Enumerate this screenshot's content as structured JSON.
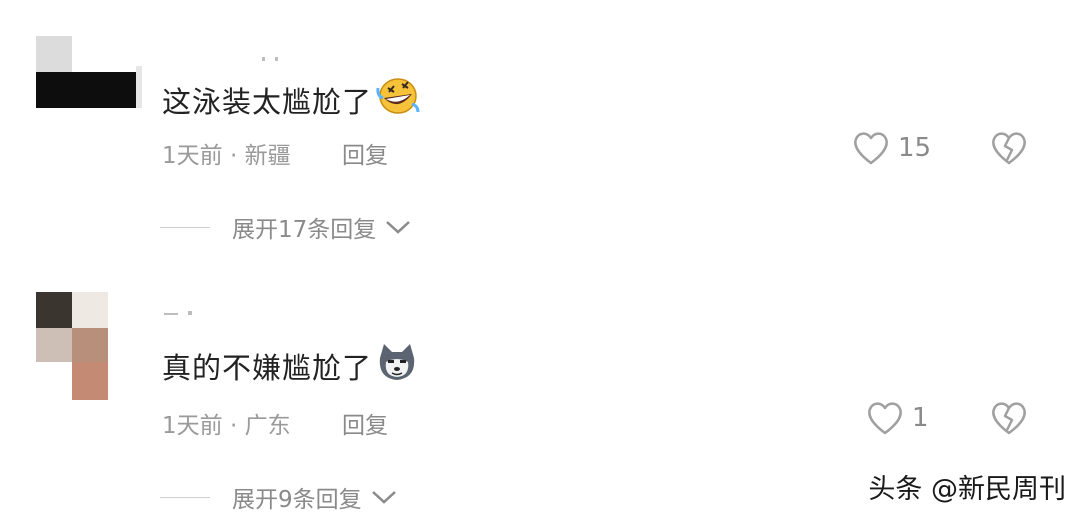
{
  "comments": [
    {
      "text": "这泳装太尴尬了",
      "emoji": "rofl-emoji",
      "time_location": "1天前 · 新疆",
      "reply_label": "回复",
      "likes": "15",
      "expand_label": "展开17条回复"
    },
    {
      "text": "真的不嫌尴尬了",
      "emoji": "husky-dog-emoji",
      "time_location": "1天前 · 广东",
      "reply_label": "回复",
      "likes": "1",
      "expand_label": "展开9条回复"
    }
  ],
  "watermark": "头条 @新民周刊",
  "icons": {
    "like": "heart-outline-icon",
    "dislike": "broken-heart-icon",
    "expand": "chevron-down-icon"
  },
  "colors": {
    "text": "#222222",
    "meta": "#9a9a9a",
    "icon": "#a0a0a0"
  }
}
